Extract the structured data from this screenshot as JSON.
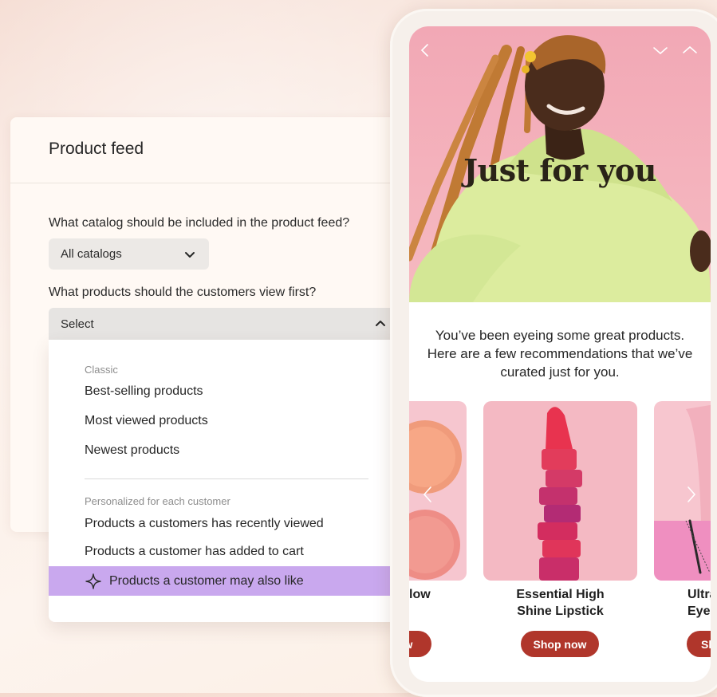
{
  "panel": {
    "title": "Product feed",
    "catalog_question": "What catalog should be included in the product feed?",
    "catalog_value": "All catalogs",
    "view_question": "What products should the customers view first?",
    "view_value": "Select"
  },
  "menu": {
    "classic_label": "Classic",
    "classic_items": [
      "Best-selling products",
      "Most viewed products",
      "Newest products"
    ],
    "personalized_label": "Personalized for each customer",
    "personalized_items": [
      "Products a customers has recently viewed",
      "Products a customer has added to cart"
    ],
    "highlighted_item": "Products a customer may also like"
  },
  "phone": {
    "hero_title": "Just for you",
    "intro_text": "You’ve been eyeing some great products. Here are a few recommendations that we’ve curated just for you.",
    "products": [
      {
        "name_line1": "low",
        "name_line2": "",
        "button": "w"
      },
      {
        "name_line1": "Essential High",
        "name_line2": "Shine Lipstick",
        "button": "Shop now"
      },
      {
        "name_line1": "Ultra",
        "name_line2": "Eye",
        "button": "Sh"
      }
    ]
  },
  "colors": {
    "highlight": "#c9a8ee",
    "button": "#b0362b",
    "hero_bg": "#f2a8b5",
    "jacket": "#d9ec9f"
  },
  "icons": {
    "select_chevron": "chevron-down-icon",
    "select_open": "chevron-up-icon",
    "highlight": "sparkle-icon"
  }
}
